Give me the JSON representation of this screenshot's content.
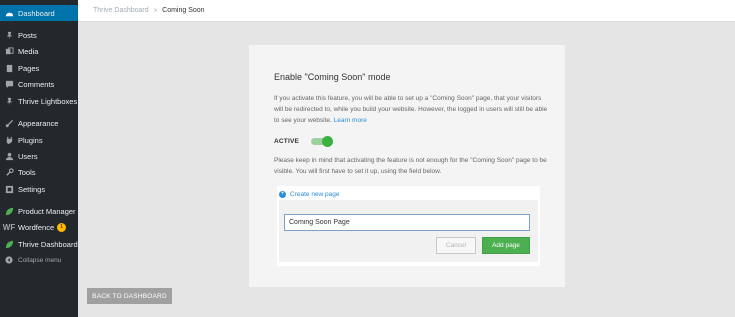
{
  "sidebar": {
    "items": [
      {
        "label": "Dashboard",
        "icon": "dashboard-icon"
      },
      {
        "label": "Posts",
        "icon": "pin-icon"
      },
      {
        "label": "Media",
        "icon": "media-icon"
      },
      {
        "label": "Pages",
        "icon": "pages-icon"
      },
      {
        "label": "Comments",
        "icon": "comment-icon"
      },
      {
        "label": "Thrive Lightboxes",
        "icon": "pin-icon"
      },
      {
        "label": "Appearance",
        "icon": "brush-icon"
      },
      {
        "label": "Plugins",
        "icon": "plugin-icon"
      },
      {
        "label": "Users",
        "icon": "user-icon"
      },
      {
        "label": "Tools",
        "icon": "wrench-icon"
      },
      {
        "label": "Settings",
        "icon": "settings-icon"
      },
      {
        "label": "Product Manager",
        "icon": "leaf-icon"
      },
      {
        "label": "Wordfence",
        "icon": "wordfence-icon",
        "badge": "1"
      },
      {
        "label": "Thrive Dashboard",
        "icon": "leaf-icon"
      },
      {
        "label": "Collapse menu",
        "icon": "collapse-icon"
      }
    ],
    "wordfence_logo_text": "WF"
  },
  "breadcrumb": {
    "root": "Thrive Dashboard",
    "separator": ">",
    "current": "Coming Soon"
  },
  "card": {
    "title": "Enable \"Coming Soon\" mode",
    "description": "If you activate this feature, you will be able to set up a \"Coming Soon\" page, that your visitors will be redirected to, while you build your website. However, the logged in users will still be able to see your website.",
    "learn_more": "Learn more",
    "active_label": "ACTIVE",
    "toggle_state": "on",
    "note": "Please keep in mind that activating the feature is not enough for the \"Coming Soon\" page to be visible. You will first have to set it up, using the field below.",
    "create_new_page": "Create new page",
    "page_name_value": "Coming Soon Page",
    "cancel_label": "Cancel",
    "add_page_label": "Add page"
  },
  "back_button": "BACK TO DASHBOARD",
  "colors": {
    "sidebar_bg": "#23282d",
    "current_item": "#0073aa",
    "accent_green": "#4caf50",
    "link_blue": "#2b8dd6"
  }
}
